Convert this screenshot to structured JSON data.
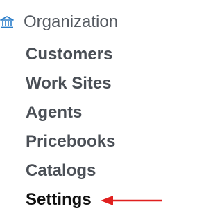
{
  "section": {
    "title": "Organization",
    "icon": "bank-icon",
    "icon_color": "#2a7dc9"
  },
  "nav": {
    "items": [
      {
        "label": "Customers",
        "name": "nav-item-customers",
        "active": false
      },
      {
        "label": "Work Sites",
        "name": "nav-item-work-sites",
        "active": false
      },
      {
        "label": "Agents",
        "name": "nav-item-agents",
        "active": false
      },
      {
        "label": "Pricebooks",
        "name": "nav-item-pricebooks",
        "active": false
      },
      {
        "label": "Catalogs",
        "name": "nav-item-catalogs",
        "active": false
      },
      {
        "label": "Settings",
        "name": "nav-item-settings",
        "active": true
      }
    ]
  },
  "annotation": {
    "icon": "red-arrow-icon",
    "color": "#e0201f"
  }
}
